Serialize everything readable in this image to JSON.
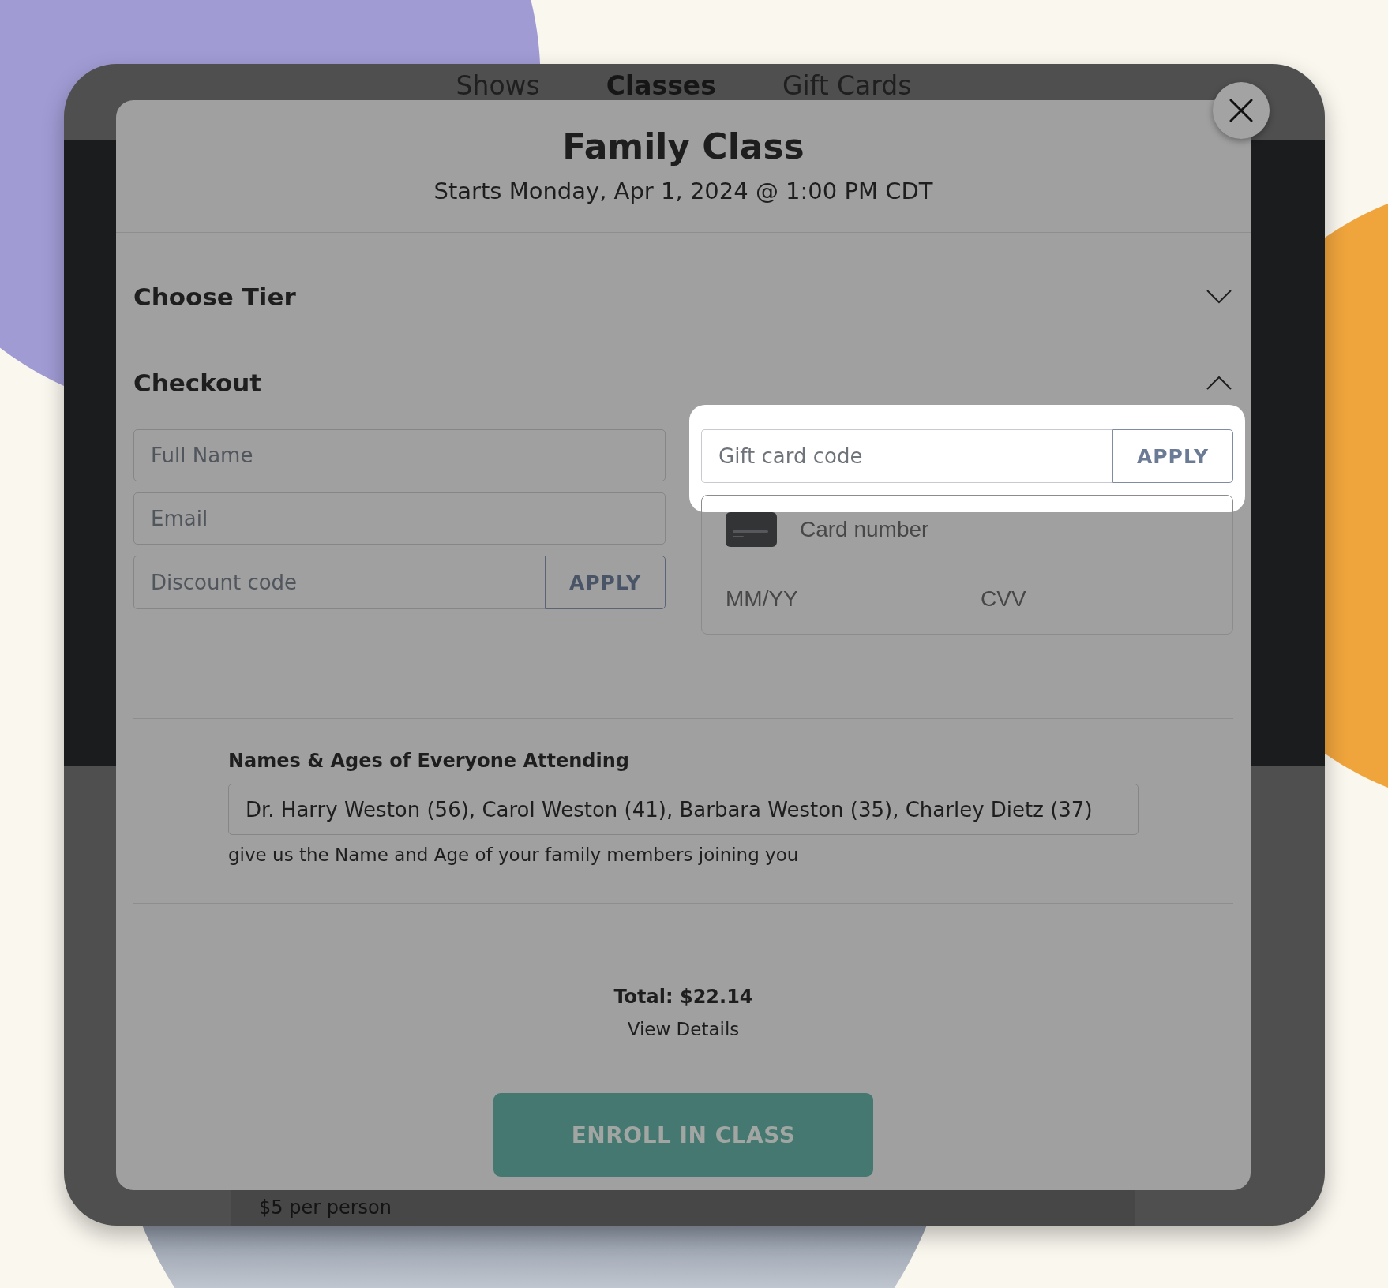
{
  "site_nav": {
    "tabs": [
      {
        "label": "Shows",
        "selected": false
      },
      {
        "label": "Classes",
        "selected": true
      },
      {
        "label": "Gift Cards",
        "selected": false
      }
    ]
  },
  "page_behind": {
    "price_note": "$5 per person"
  },
  "modal": {
    "title": "Family Class",
    "subtitle": "Starts Monday, Apr 1, 2024 @ 1:00 PM CDT",
    "sections": [
      {
        "title": "Choose Tier",
        "expanded": false
      },
      {
        "title": "Checkout",
        "expanded": true,
        "body": {
          "fields": [
            {
              "placeholder": "Full Name"
            },
            {
              "placeholder": "Email"
            }
          ],
          "discount": {
            "placeholder": "Discount code",
            "button": "APPLY"
          },
          "gift_card": {
            "placeholder": "Gift card code",
            "button": "APPLY",
            "spotlight": true
          },
          "card": {
            "number_placeholder": "Card number",
            "expiry_placeholder": "MM/YY",
            "cvv_placeholder": "CVV"
          }
        }
      }
    ],
    "attendees": {
      "label": "Names & Ages of Everyone Attending",
      "value": "Dr. Harry Weston (56), Carol Weston (41), Barbara Weston (35), Charley Dietz (37)",
      "help": "give us the Name and Age of your family members joining you"
    },
    "total": "Total: $22.14",
    "details_link": "View Details",
    "submit_button": "ENROLL IN CLASS"
  }
}
